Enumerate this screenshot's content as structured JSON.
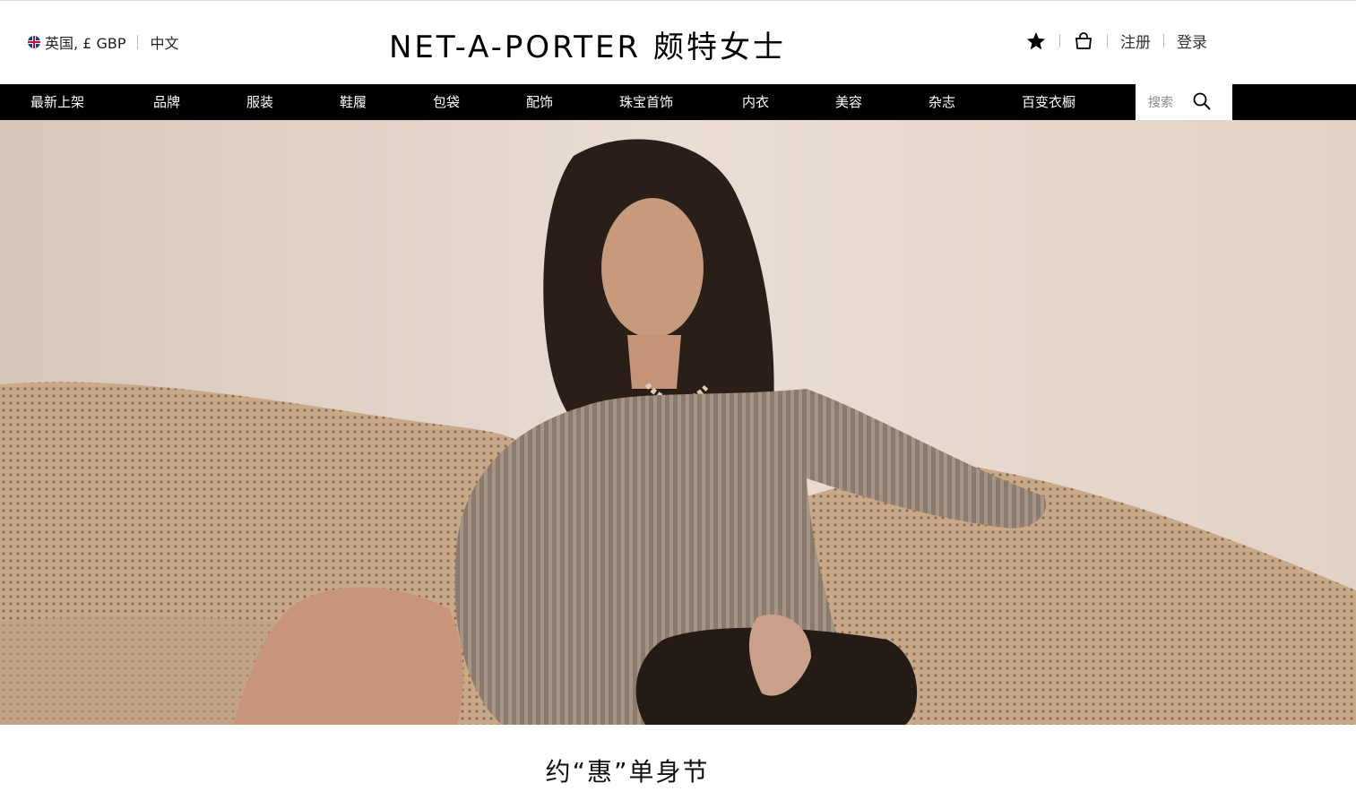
{
  "header": {
    "locale": "英国, £ GBP",
    "language": "中文",
    "logo_text": "NET-A-PORTER 颇特女士",
    "wishlist_icon": "star-icon",
    "bag_icon": "shopping-bag-icon",
    "register": "注册",
    "login": "登录"
  },
  "nav": {
    "items": [
      "最新上架",
      "品牌",
      "服装",
      "鞋履",
      "包袋",
      "配饰",
      "珠宝首饰",
      "内衣",
      "美容",
      "杂志",
      "百变衣橱"
    ]
  },
  "search": {
    "placeholder": "搜索",
    "icon": "search-icon"
  },
  "hero": {
    "image": "model-on-sofa-photo"
  },
  "promo": {
    "title": "约“惠”单身节"
  },
  "colors": {
    "nav_bg": "#000000",
    "nav_text": "#ffffff",
    "text": "#222222"
  }
}
